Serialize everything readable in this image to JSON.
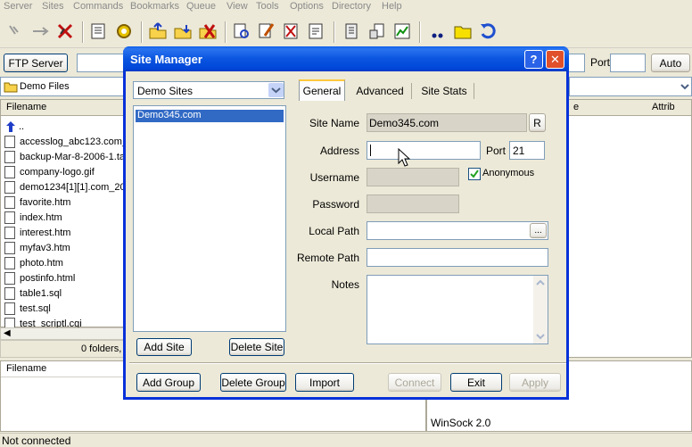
{
  "menu": [
    "Server",
    "Sites",
    "Commands",
    "Bookmarks",
    "Queue",
    "View",
    "Tools",
    "Options",
    "Directory",
    "Help"
  ],
  "connbar": {
    "ftp_server_label": "FTP Server",
    "port_label": "Port",
    "mode_label": "Auto"
  },
  "left_panel": {
    "path": "Demo Files",
    "column_filename": "Filename",
    "up_item": "..",
    "files": [
      "accesslog_abc123.com_",
      "backup-Mar-8-2006-1.tar",
      "company-logo.gif",
      "demo1234[1][1].com_20",
      "favorite.htm",
      "index.htm",
      "interest.htm",
      "myfav3.htm",
      "photo.htm",
      "postinfo.html",
      "table1.sql",
      "test.sql",
      "test_scriptl.cgi"
    ],
    "status": "0 folders,"
  },
  "right_panel": {
    "col_size_partial": "e",
    "col_attrib": "Attrib"
  },
  "queue_panel": {
    "column_filename": "Filename"
  },
  "log_panel": {
    "winsock": "WinSock 2.0"
  },
  "statusbar": {
    "text": "Not connected"
  },
  "dialog": {
    "title": "Site Manager",
    "help_glyph": "?",
    "close_glyph": "✕",
    "site_group_selected": "Demo Sites",
    "sites": [
      "Demo345.com"
    ],
    "tabs": [
      "General",
      "Advanced",
      "Site Stats"
    ],
    "labels": {
      "site_name": "Site Name",
      "address": "Address",
      "port": "Port",
      "username": "Username",
      "password": "Password",
      "local_path": "Local Path",
      "remote_path": "Remote Path",
      "notes": "Notes",
      "anonymous": "Anonymous"
    },
    "values": {
      "site_name": "Demo345.com",
      "address": "",
      "port": "21",
      "username": "",
      "password": "",
      "local_path": "",
      "remote_path": ""
    },
    "anonymous_checked": true,
    "rename_button": "R",
    "browse_button": "...",
    "buttons": {
      "add_site": "Add Site",
      "delete_site": "Delete Site",
      "add_group": "Add Group",
      "delete_group": "Delete Group",
      "import": "Import",
      "connect": "Connect",
      "exit": "Exit",
      "apply": "Apply"
    }
  },
  "colors": {
    "titlebar": "#0a55e0",
    "selection": "#316ac5",
    "window_bg": "#ece9d8"
  }
}
